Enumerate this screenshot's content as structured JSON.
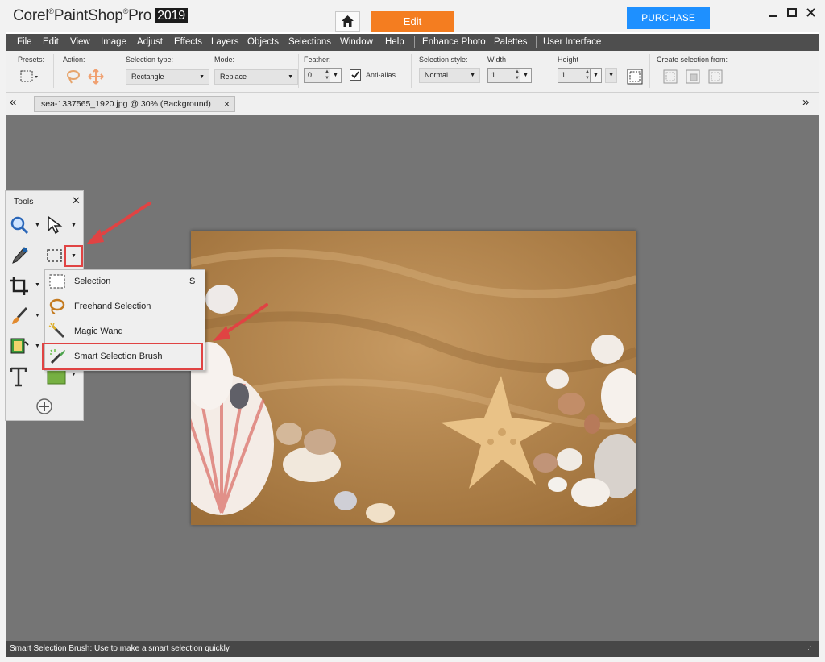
{
  "titlebar": {
    "brand": "Corel",
    "product": "PaintShop",
    "pro": "Pro",
    "year": "2019",
    "home_icon": "home-icon",
    "edit_tab": "Edit",
    "purchase": "PURCHASE"
  },
  "menubar": {
    "items": [
      "File",
      "Edit",
      "View",
      "Image",
      "Adjust",
      "Effects",
      "Layers",
      "Objects",
      "Selections",
      "Window",
      "Help",
      "Enhance Photo",
      "Palettes",
      "User Interface"
    ]
  },
  "options": {
    "presets_label": "Presets:",
    "action_label": "Action:",
    "selection_type_label": "Selection type:",
    "selection_type_value": "Rectangle",
    "mode_label": "Mode:",
    "mode_value": "Replace",
    "feather_label": "Feather:",
    "feather_value": "0",
    "antialias_label": "Anti-alias",
    "antialias_checked": true,
    "selection_style_label": "Selection style:",
    "selection_style_value": "Normal",
    "width_label": "Width",
    "width_value": "1",
    "height_label": "Height",
    "height_value": "1",
    "create_from_label": "Create selection from:"
  },
  "doc_tab": {
    "title": "sea-1337565_1920.jpg @  30% (Background)"
  },
  "tools_palette": {
    "title": "Tools",
    "tools": [
      "zoom-icon",
      "pick-arrow-icon",
      "dropper-icon",
      "selection-rect-icon",
      "crop-icon",
      "paint-brush-icon",
      "fill-icon",
      "color-swatch-icon",
      "text-icon",
      "add-tool-icon"
    ]
  },
  "flyout": {
    "items": [
      {
        "label": "Selection",
        "shortcut": "S",
        "icon": "selection-rect-icon"
      },
      {
        "label": "Freehand Selection",
        "shortcut": "",
        "icon": "lasso-icon"
      },
      {
        "label": "Magic Wand",
        "shortcut": "",
        "icon": "magic-wand-icon"
      },
      {
        "label": "Smart Selection Brush",
        "shortcut": "",
        "icon": "smart-brush-icon"
      }
    ]
  },
  "statusbar": {
    "text": "Smart Selection Brush: Use to make a smart selection quickly."
  },
  "colors": {
    "accent_orange": "#f47d20",
    "purchase_blue": "#1e90ff",
    "annotation_red": "#e04343",
    "workspace_gray": "#757575"
  }
}
